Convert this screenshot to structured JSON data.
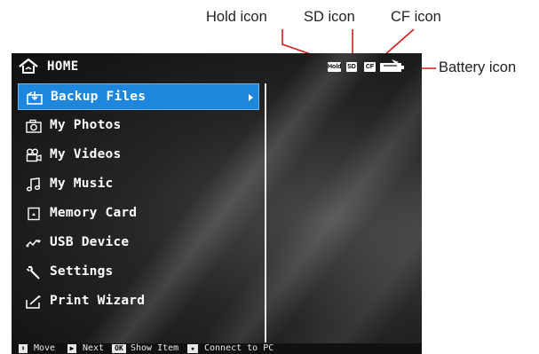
{
  "callouts": {
    "hold": "Hold icon",
    "sd": "SD icon",
    "cf": "CF icon",
    "battery": "Battery icon"
  },
  "header": {
    "title": "HOME",
    "status": {
      "hold": "Hold",
      "sd": "SD",
      "cf": "CF"
    }
  },
  "menu": {
    "selected_index": 0,
    "items": [
      {
        "label": "Backup Files",
        "icon": "backup-icon"
      },
      {
        "label": "My Photos",
        "icon": "camera-icon"
      },
      {
        "label": "My Videos",
        "icon": "video-icon"
      },
      {
        "label": "My Music",
        "icon": "music-note-icon"
      },
      {
        "label": "Memory Card",
        "icon": "memory-card-icon"
      },
      {
        "label": "USB Device",
        "icon": "usb-icon"
      },
      {
        "label": "Settings",
        "icon": "wrench-icon"
      },
      {
        "label": "Print Wizard",
        "icon": "print-wizard-icon"
      }
    ]
  },
  "footer": {
    "move": "Move",
    "next": "Next",
    "ok_key": "OK",
    "show_item": "Show Item",
    "star_key": "★",
    "connect": "Connect to PC"
  },
  "colors": {
    "selection": "#1f86de",
    "screen_bg": "#1a1a1a"
  }
}
